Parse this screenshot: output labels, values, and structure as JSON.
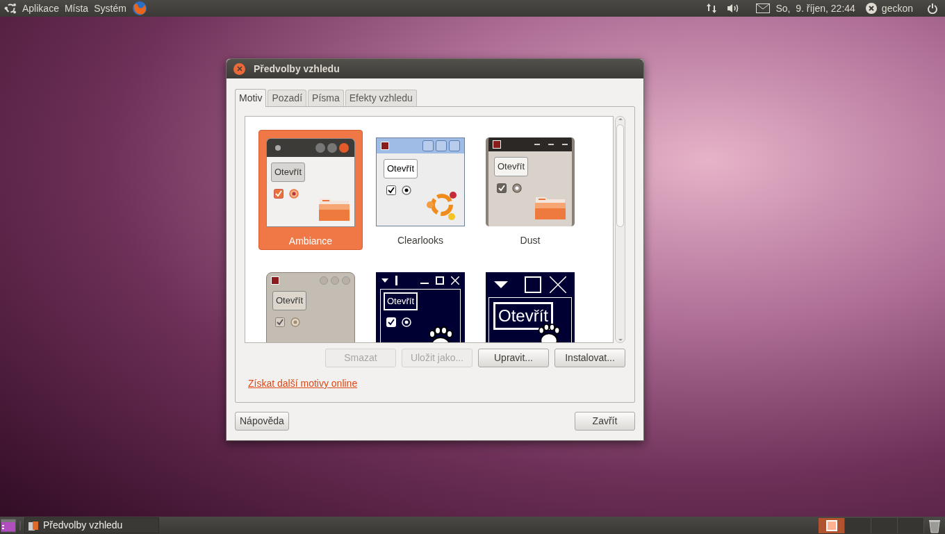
{
  "top_panel": {
    "menus": [
      "Aplikace",
      "Místa",
      "Systém"
    ],
    "clock": "So,  9. říjen, 22:44",
    "user": "geckon"
  },
  "dialog": {
    "title": "Předvolby vzhledu",
    "tabs": [
      {
        "label": "Motiv",
        "selected": true
      },
      {
        "label": "Pozadí",
        "selected": false
      },
      {
        "label": "Písma",
        "selected": false
      },
      {
        "label": "Efekty vzhledu",
        "selected": false
      }
    ],
    "themes": [
      {
        "kind": "ambiance",
        "name": "Ambiance",
        "button": "Otevřít",
        "selected": true
      },
      {
        "kind": "clearlooks",
        "name": "Clearlooks",
        "button": "Otevřít",
        "selected": false
      },
      {
        "kind": "dust",
        "name": "Dust",
        "button": "Otevřít",
        "selected": false
      },
      {
        "kind": "dust-sand",
        "button": "Otevřít",
        "selected": false
      },
      {
        "kind": "contrast-inverse",
        "button": "Otevřít",
        "selected": false
      },
      {
        "kind": "contrast-large",
        "button": "Otevřít",
        "selected": false
      }
    ],
    "actions": [
      {
        "label": "Smazat",
        "disabled": true
      },
      {
        "label": "Uložit jako...",
        "disabled": true
      },
      {
        "label": "Upravit...",
        "disabled": false
      },
      {
        "label": "Instalovat...",
        "disabled": false
      }
    ],
    "link": "Získat další motivy online",
    "help_button": "Nápověda",
    "close_button": "Zavřít"
  },
  "taskbar": {
    "window_button": "Předvolby vzhledu",
    "workspaces": [
      {
        "selected": true
      },
      {
        "selected": false
      },
      {
        "selected": false
      },
      {
        "selected": false
      }
    ]
  }
}
